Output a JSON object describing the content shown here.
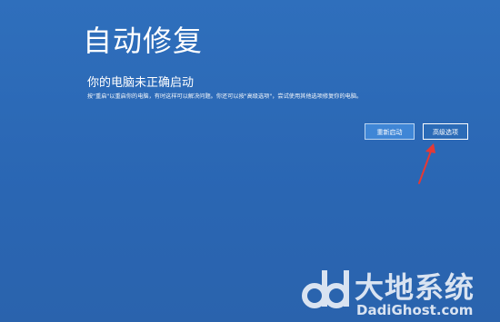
{
  "page": {
    "title": "自动修复",
    "subtitle": "你的电脑未正确启动",
    "body": "按\"重启\"以重启你的电脑，有时这样可以解决问题。你还可以按\"高级选项\"，尝试使用其他选项修复你的电脑。"
  },
  "buttons": {
    "restart": "重新启动",
    "advanced": "高级选项"
  },
  "annotation": {
    "arrow_color": "#e53935",
    "arrow_icon": "red-arrow-pointing-to-advanced-options"
  },
  "watermark": {
    "brand_cn": "大地系统",
    "brand_en": "DadiGhost.com"
  },
  "colors": {
    "background": "#2b6bb7",
    "button_restart_bg": "#3f86d6"
  }
}
